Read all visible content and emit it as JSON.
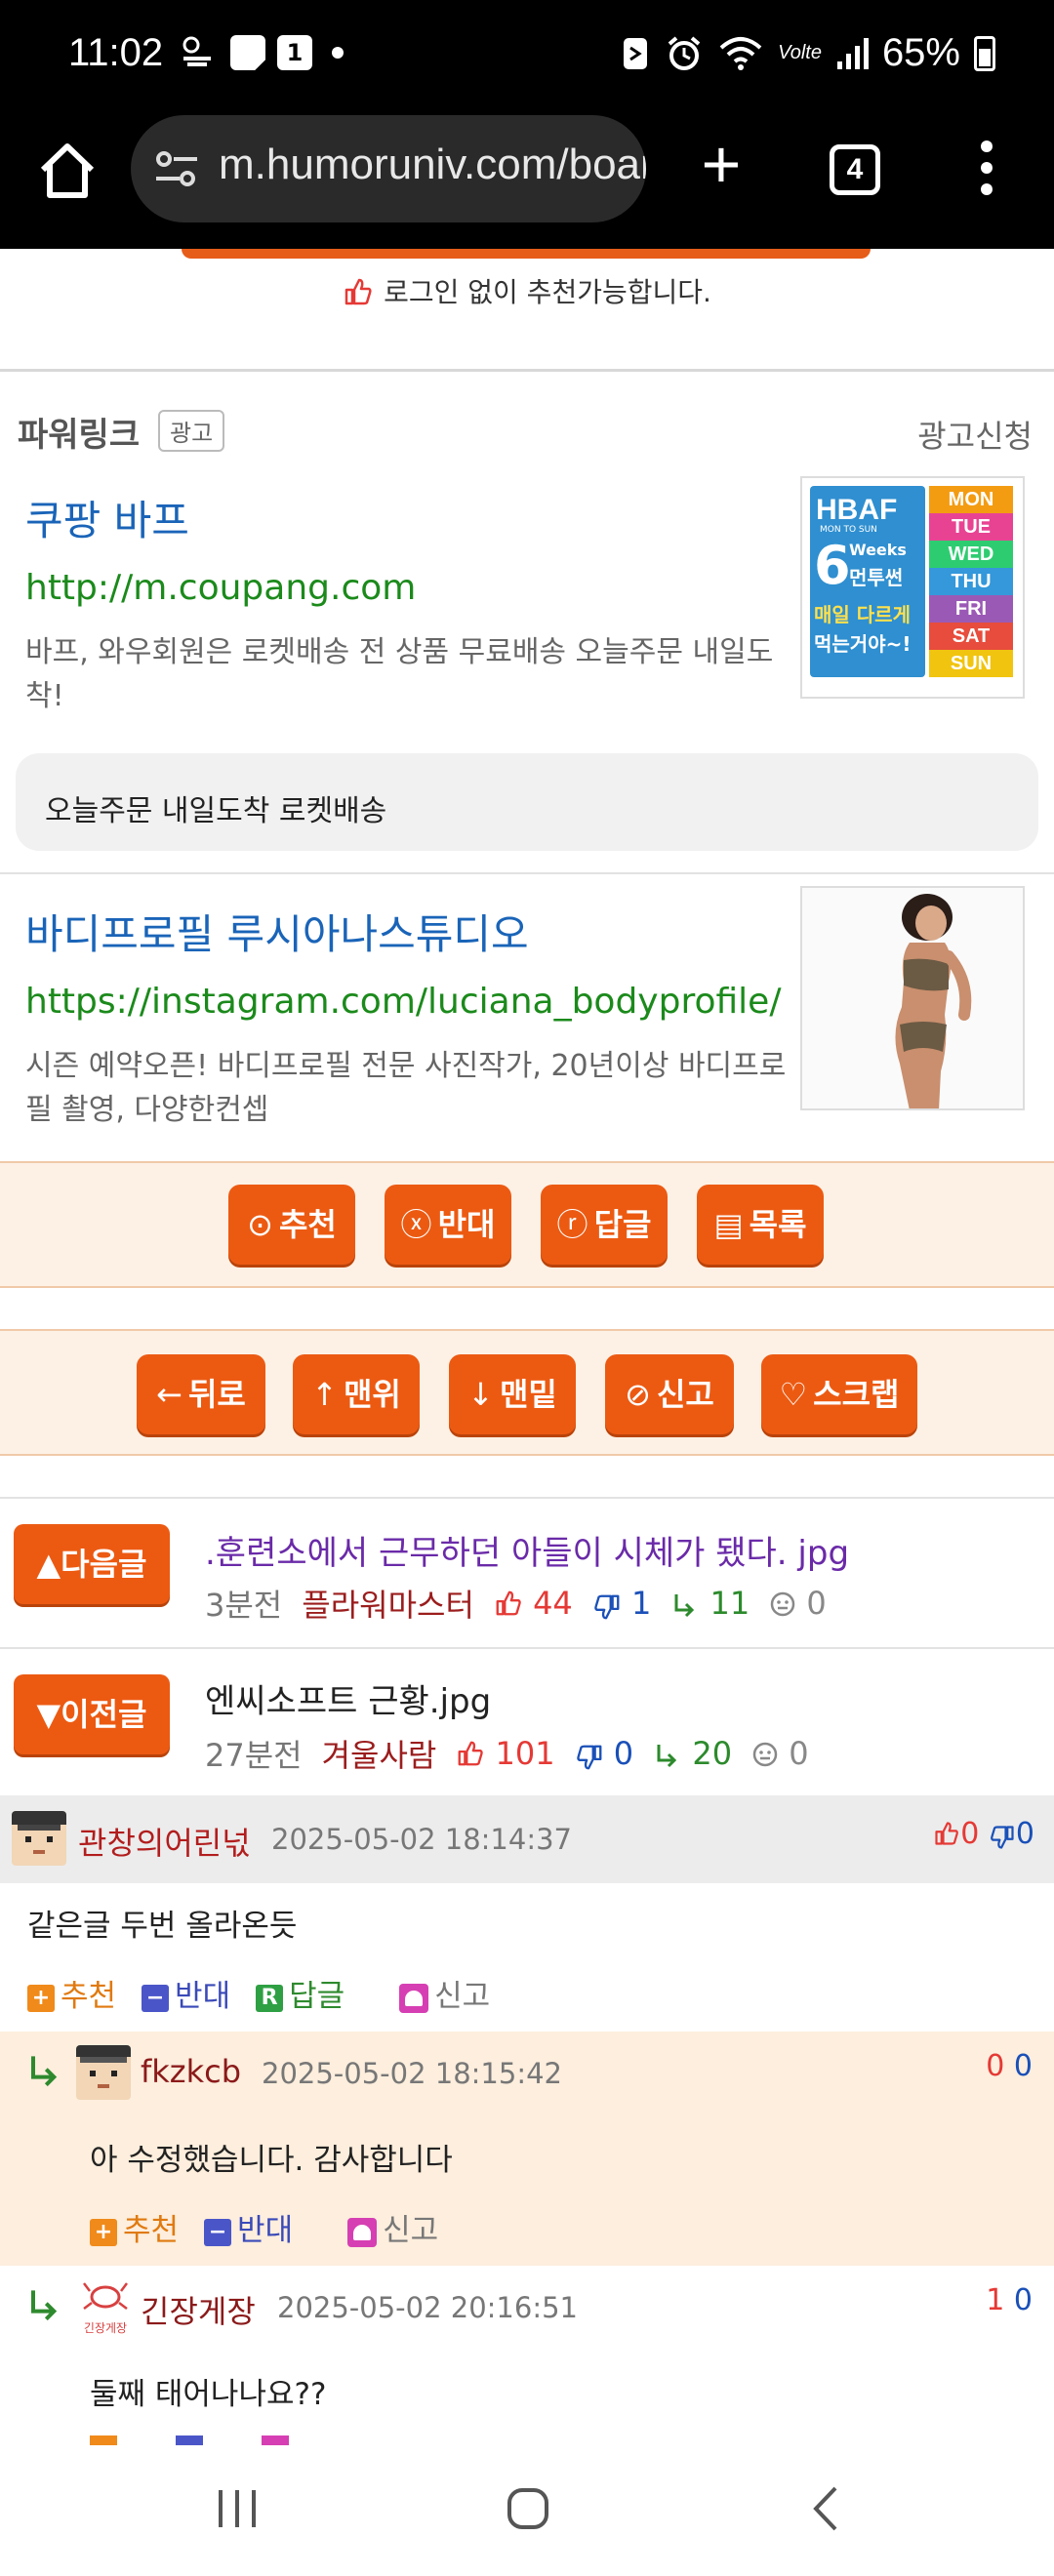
{
  "status_bar": {
    "time": "11:02",
    "sub_icon_text": "중앙\n알림",
    "badge_number": "1",
    "lte": "Volte",
    "battery": "65%"
  },
  "browser": {
    "url": "m.humoruniv.com/board",
    "tab_count": "4"
  },
  "recommend_note": "로그인 없이 추천가능합니다.",
  "powerlink": {
    "title": "파워링크",
    "badge": "광고",
    "apply": "광고신청",
    "ads": [
      {
        "title": "쿠팡 바프",
        "url": "http://m.coupang.com",
        "desc": "바프, 와우회원은 로켓배송 전 상품 무료배송 오늘주문 내일도착!",
        "extension": "오늘주문 내일도착 로켓배송",
        "image_text": {
          "brand": "HBAF",
          "brand_sub": "MON TO SUN",
          "weeks_num": "6",
          "weeks": "Weeks",
          "line1": "먼투썬",
          "line2": "매일 다르게",
          "line3": "먹는거야~!",
          "days": [
            "MON",
            "TUE",
            "WED",
            "THU",
            "FRI",
            "SAT",
            "SUN"
          ]
        }
      },
      {
        "title": "바디프로필 루시아나스튜디오",
        "url": "https://instagram.com/luciana_bodyprofile/",
        "desc": "시즌 예약오픈! 바디프로필 전문 사진작가, 20년이상 바디프로필 촬영, 다양한컨셉"
      }
    ]
  },
  "action_buttons": [
    {
      "icon": "⊙",
      "label": "추천"
    },
    {
      "icon": "ⓧ",
      "label": "반대"
    },
    {
      "icon": "ⓡ",
      "label": "답글"
    },
    {
      "icon": "▤",
      "label": "목록"
    }
  ],
  "nav_buttons": [
    {
      "icon": "←",
      "label": "뒤로"
    },
    {
      "icon": "↑",
      "label": "맨위"
    },
    {
      "icon": "↓",
      "label": "맨밑"
    },
    {
      "icon": "⊘",
      "label": "신고"
    },
    {
      "icon": "♡",
      "label": "스크랩"
    }
  ],
  "next_post": {
    "button": "▲다음글",
    "title": ".훈련소에서 근무하던 아들이 시체가 됐다. jpg",
    "time": "3분전",
    "author": "플라워마스터",
    "up": "44",
    "down": "1",
    "replies": "11",
    "other": "0"
  },
  "prev_post": {
    "button": "▼이전글",
    "title": "엔씨소프트 근황.jpg",
    "time": "27분전",
    "author": "겨울사람",
    "up": "101",
    "down": "0",
    "replies": "20",
    "other": "0"
  },
  "comments": [
    {
      "author": "관창의어린넋",
      "date": "2025-05-02 18:14:37",
      "up": "0",
      "down": "0",
      "body": "같은글 두번 올라온듯",
      "actions": {
        "up": "추천",
        "down": "반대",
        "reply": "답글",
        "report": "신고"
      }
    },
    {
      "author": "fkzkcb",
      "date": "2025-05-02 18:15:42",
      "up": "0",
      "down": "0",
      "body": "아 수정했습니다. 감사합니다",
      "actions": {
        "up": "추천",
        "down": "반대",
        "report": "신고"
      }
    },
    {
      "author": "긴장게장",
      "avatar_caption": "긴장게장",
      "date": "2025-05-02 20:16:51",
      "up": "1",
      "down": "0",
      "body": "둘째 태어나나요??"
    }
  ]
}
